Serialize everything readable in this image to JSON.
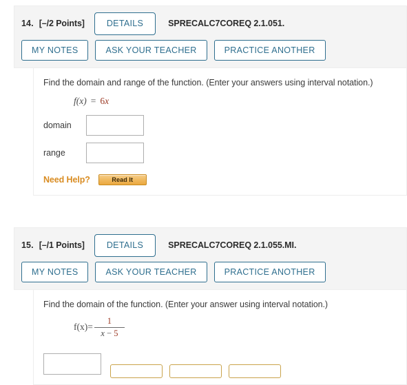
{
  "questions": [
    {
      "number": "14.",
      "points": "[–/2 Points]",
      "details_label": "DETAILS",
      "code": "SPRECALC7COREQ 2.1.051.",
      "actions": [
        "MY NOTES",
        "ASK YOUR TEACHER",
        "PRACTICE ANOTHER"
      ],
      "prompt": "Find the domain and range of the function. (Enter your answers using interval notation.)",
      "formula": {
        "lhs": "f(x)",
        "eq": "=",
        "coefficient": "6",
        "variable": "x"
      },
      "fields": [
        {
          "label": "domain",
          "value": "",
          "placeholder": ""
        },
        {
          "label": "range",
          "value": "",
          "placeholder": ""
        }
      ],
      "need_help_label": "Need Help?",
      "read_it_label": "Read It"
    },
    {
      "number": "15.",
      "points": "[–/1 Points]",
      "details_label": "DETAILS",
      "code": "SPRECALC7COREQ 2.1.055.MI.",
      "actions": [
        "MY NOTES",
        "ASK YOUR TEACHER",
        "PRACTICE ANOTHER"
      ],
      "prompt": "Find the domain of the function. (Enter your answer using interval notation.)",
      "formula": {
        "lhs": "f(x)",
        "eq": "=",
        "numerator": "1",
        "den_variable": "x",
        "den_operator": "−",
        "den_value": "5"
      },
      "fields": [
        {
          "label": "",
          "value": "",
          "placeholder": ""
        }
      ]
    }
  ],
  "colors": {
    "button_border": "#2e6e8e",
    "button_text": "#2e6e8e",
    "header_background": "#f4f4f4",
    "math_highlight": "#9c3b26",
    "need_help_orange": "#d98c22",
    "read_it_border": "#c98a1e"
  }
}
